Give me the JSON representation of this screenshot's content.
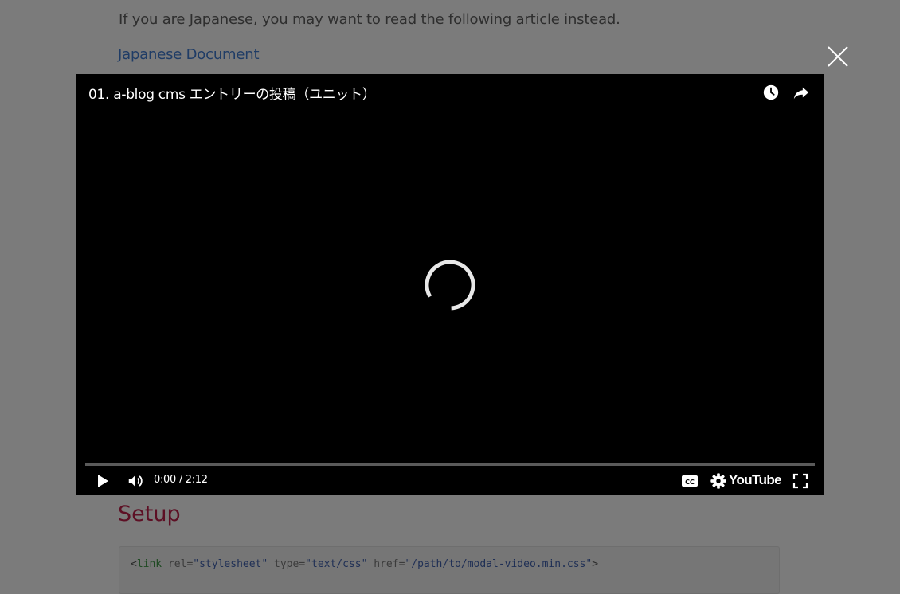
{
  "page": {
    "intro_text": "If you are Japanese, you may want to read the following article instead.",
    "japanese_link": "Japanese Document",
    "setup_heading": "Setup",
    "code_line": {
      "open": "<",
      "tag": "link",
      "attr1": " rel=",
      "val1": "\"stylesheet\"",
      "attr2": " type=",
      "val2": "\"text/css\"",
      "attr3": " href=",
      "val3": "\"/path/to/modal-video.min.css\"",
      "close": ">"
    }
  },
  "player": {
    "title": "01. a-blog cms エントリーの投稿（ユニット）",
    "time_display": "0:00 / 2:12",
    "youtube_label": "YouTube",
    "progress_fraction": 0
  },
  "icons": {
    "close": "close-icon",
    "watch_later": "clock-icon",
    "share": "share-icon",
    "loading": "loading-spinner-icon",
    "play": "play-icon",
    "volume": "volume-icon",
    "captions": "captions-icon",
    "settings": "gear-icon",
    "fullscreen": "fullscreen-icon"
  },
  "colors": {
    "overlay_bg": "#7b7b7b",
    "player_bg": "#000000",
    "progress_track": "#5a5a5a",
    "link": "#1f3c66",
    "heading": "#5d0f24"
  }
}
